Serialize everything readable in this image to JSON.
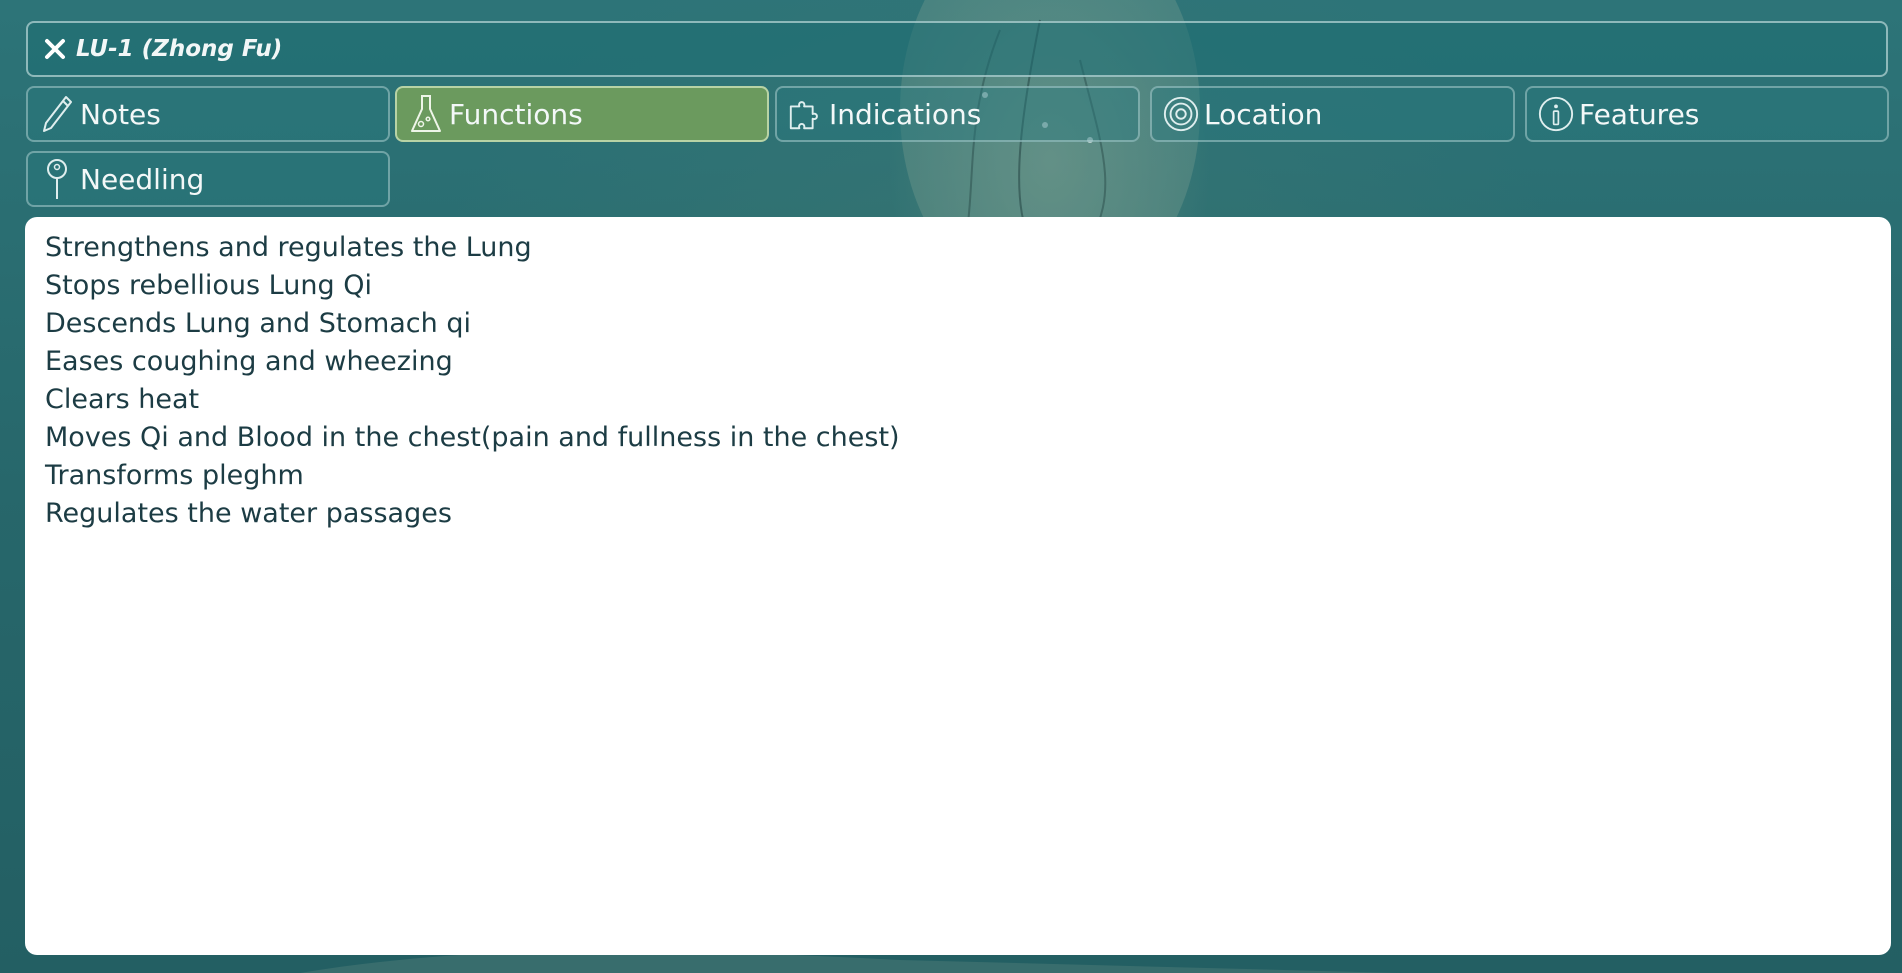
{
  "header": {
    "title": "LU-1 (Zhong Fu)",
    "close_icon": "close-icon"
  },
  "tabs": [
    {
      "id": "notes",
      "label": "Notes",
      "icon": "pencil-icon",
      "active": false
    },
    {
      "id": "functions",
      "label": "Functions",
      "icon": "flask-icon",
      "active": true
    },
    {
      "id": "indications",
      "label": "Indications",
      "icon": "puzzle-icon",
      "active": false
    },
    {
      "id": "location",
      "label": "Location",
      "icon": "target-icon",
      "active": false
    },
    {
      "id": "features",
      "label": "Features",
      "icon": "info-icon",
      "active": false
    },
    {
      "id": "needling",
      "label": "Needling",
      "icon": "pin-icon",
      "active": false
    }
  ],
  "functions": {
    "items": [
      "Strengthens and regulates the Lung",
      "Stops rebellious Lung Qi",
      "Descends Lung and Stomach qi",
      "Eases coughing and wheezing",
      "Clears heat",
      "Moves Qi and Blood in the chest(pain and fullness in the chest)",
      "Transforms pleghm",
      "Regulates the water passages"
    ]
  },
  "colors": {
    "background": "#2c6f73",
    "active_tab": "#6b9a5e",
    "tab_border": "#c8e1e1",
    "text_dark": "#1c3c44",
    "text_light": "#f3f8f8"
  }
}
